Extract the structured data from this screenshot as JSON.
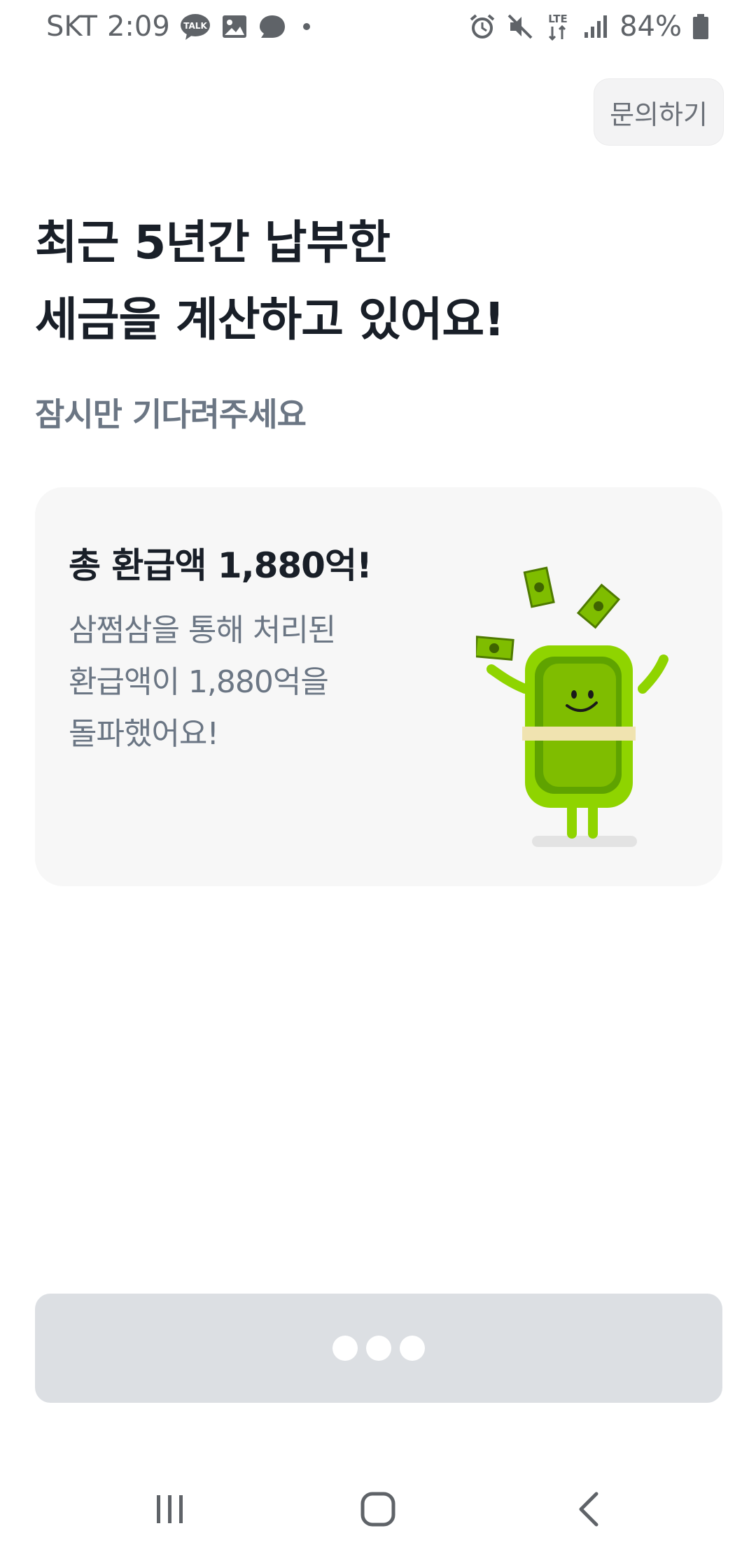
{
  "status_bar": {
    "carrier": "SKT",
    "time": "2:09",
    "kakaotalk_label": "TALK",
    "network": "LTE",
    "battery": "84%",
    "icons_left": [
      "kakaotalk-icon",
      "gallery-icon",
      "chat-bubble-icon",
      "dot-icon"
    ],
    "icons_right": [
      "alarm-icon",
      "mute-icon",
      "lte-icon",
      "signal-icon",
      "battery-icon"
    ]
  },
  "header": {
    "inquiry_label": "문의하기"
  },
  "main": {
    "headline_line1": "최근 5년간 납부한",
    "headline_line2": "세금을 계산하고 있어요!",
    "subtitle": "잠시만 기다려주세요"
  },
  "card": {
    "title": "총 환급액 1,880억!",
    "body_line1": "삼쩜삼을 통해 처리된",
    "body_line2": "환급액이 1,880억을",
    "body_line3": "돌파했어요!"
  },
  "loading_button": {
    "dots": 3
  },
  "nav_bar": {
    "icons": [
      "recent-apps-icon",
      "home-icon",
      "back-icon"
    ]
  },
  "colors": {
    "headline": "#191f28",
    "subtext": "#6b7684",
    "card_bg": "#f7f7f7",
    "button_bg": "#dcdfe3",
    "mascot_green": "#7fbd00"
  }
}
